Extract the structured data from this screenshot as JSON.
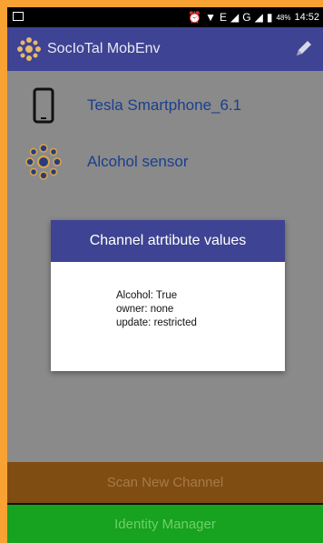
{
  "status_bar": {
    "battery": "48%",
    "time": "14:52",
    "network_label": "E",
    "network_label_2": "G"
  },
  "app_bar": {
    "title": "SocIoTal MobEnv"
  },
  "channels": [
    {
      "label": "Tesla Smartphone_6.1",
      "icon": "smartphone-icon"
    },
    {
      "label": "Alcohol sensor",
      "icon": "sensor-icon"
    }
  ],
  "dialog": {
    "title": "Channel atrtibute values",
    "lines": [
      "Alcohol: True",
      "owner: none",
      "update: restricted"
    ]
  },
  "buttons": {
    "scan": "Scan New Channel",
    "identity": "Identity Manager"
  },
  "colors": {
    "frame": "#f7a233",
    "app_bar": "#3e4393",
    "scan_button": "#7f4d12",
    "identity_button": "#17a21f",
    "list_text": "#1a3f8f"
  }
}
